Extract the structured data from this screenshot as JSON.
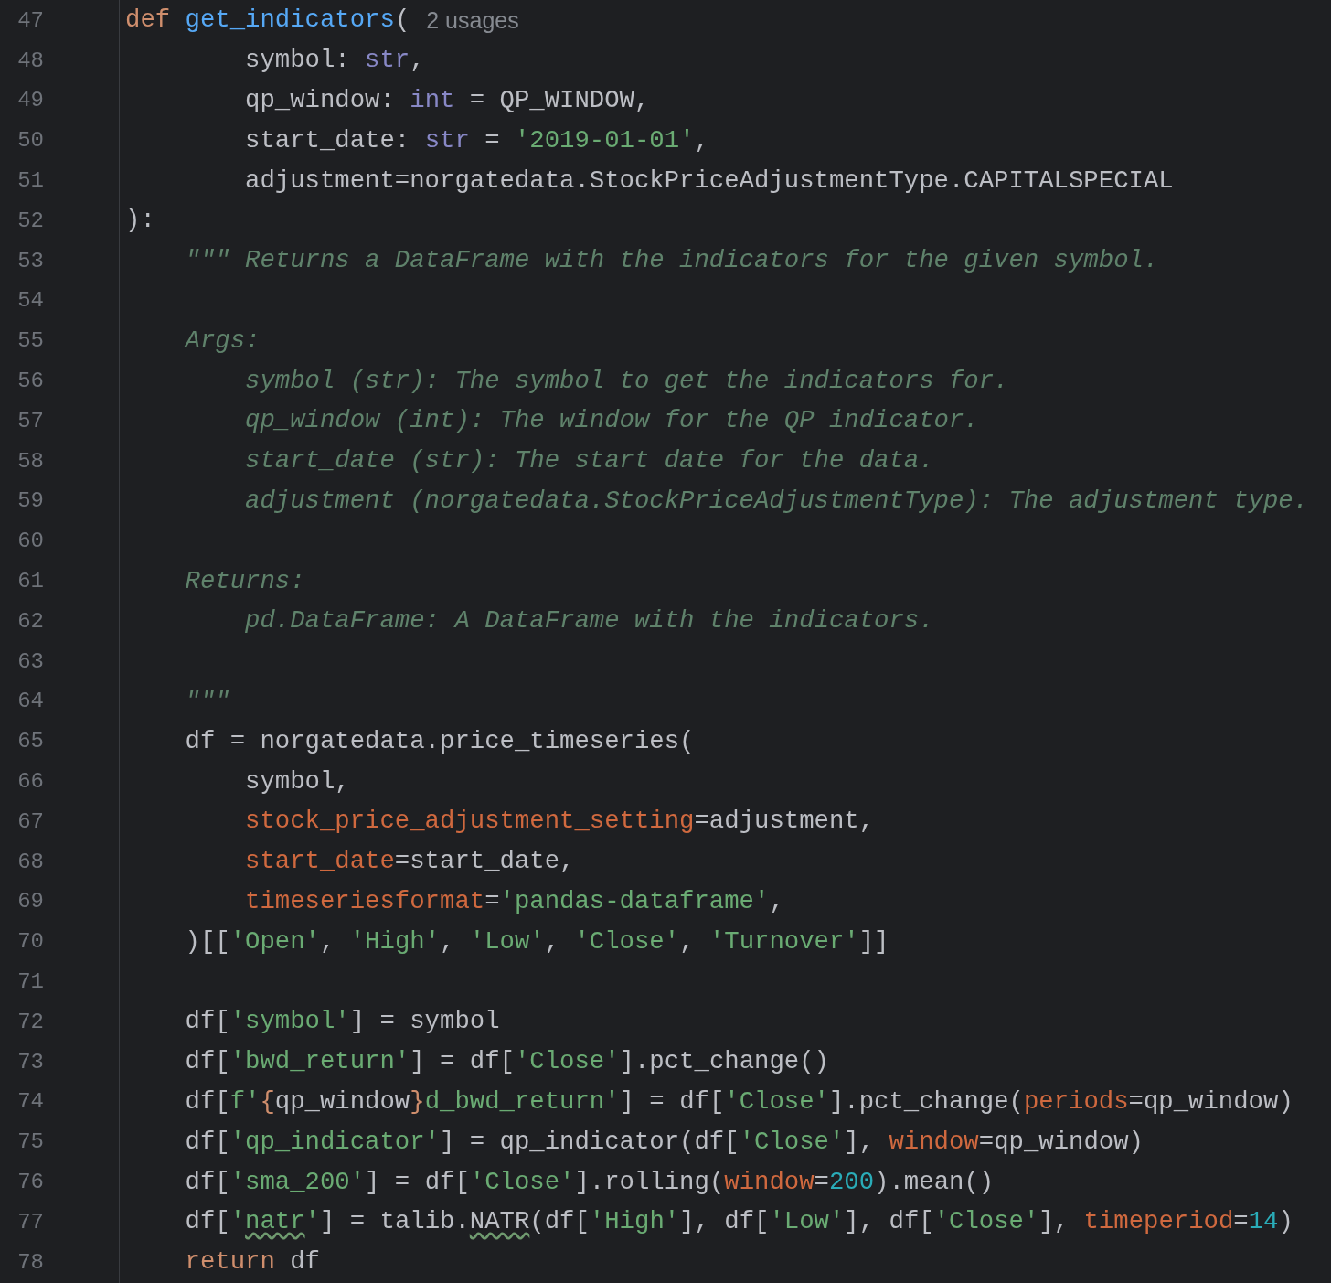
{
  "lines": [
    {
      "number": "47",
      "tokens": [
        {
          "text": "def ",
          "kind": "keyword"
        },
        {
          "text": "get_indicators",
          "kind": "function"
        },
        {
          "text": "(",
          "kind": "plain"
        },
        {
          "text": "2 usages",
          "kind": "hint"
        }
      ]
    },
    {
      "number": "48",
      "tokens": [
        {
          "text": "        symbol: ",
          "kind": "plain"
        },
        {
          "text": "str",
          "kind": "type"
        },
        {
          "text": ",",
          "kind": "plain"
        }
      ]
    },
    {
      "number": "49",
      "tokens": [
        {
          "text": "        qp_window: ",
          "kind": "plain"
        },
        {
          "text": "int",
          "kind": "type"
        },
        {
          "text": " = QP_WINDOW,",
          "kind": "plain"
        }
      ]
    },
    {
      "number": "50",
      "tokens": [
        {
          "text": "        start_date: ",
          "kind": "plain"
        },
        {
          "text": "str",
          "kind": "type"
        },
        {
          "text": " = ",
          "kind": "plain"
        },
        {
          "text": "'2019-01-01'",
          "kind": "string"
        },
        {
          "text": ",",
          "kind": "plain"
        }
      ]
    },
    {
      "number": "51",
      "tokens": [
        {
          "text": "        adjustment=norgatedata.StockPriceAdjustmentType.CAPITALSPECIAL",
          "kind": "plain"
        }
      ]
    },
    {
      "number": "52",
      "tokens": [
        {
          "text": "):",
          "kind": "plain"
        }
      ]
    },
    {
      "number": "53",
      "tokens": [
        {
          "text": "    \"\"\" Returns a DataFrame with the indicators for the given symbol.",
          "kind": "doc"
        }
      ]
    },
    {
      "number": "54"
    },
    {
      "number": "55",
      "tokens": [
        {
          "text": "    Args:",
          "kind": "doc"
        }
      ]
    },
    {
      "number": "56",
      "tokens": [
        {
          "text": "        symbol (str): The symbol to get the indicators for.",
          "kind": "doc"
        }
      ]
    },
    {
      "number": "57",
      "tokens": [
        {
          "text": "        qp_window (int): The window for the QP indicator.",
          "kind": "doc"
        }
      ]
    },
    {
      "number": "58",
      "tokens": [
        {
          "text": "        start_date (str): The start date for the data.",
          "kind": "doc"
        }
      ]
    },
    {
      "number": "59",
      "tokens": [
        {
          "text": "        adjustment (norgatedata.StockPriceAdjustmentType): The adjustment type.",
          "kind": "doc"
        }
      ]
    },
    {
      "number": "60"
    },
    {
      "number": "61",
      "tokens": [
        {
          "text": "    Returns:",
          "kind": "doc"
        }
      ]
    },
    {
      "number": "62",
      "tokens": [
        {
          "text": "        pd.DataFrame: A DataFrame with the indicators.",
          "kind": "doc"
        }
      ]
    },
    {
      "number": "63"
    },
    {
      "number": "64",
      "tokens": [
        {
          "text": "    \"\"\"",
          "kind": "doc"
        }
      ]
    },
    {
      "number": "65",
      "tokens": [
        {
          "text": "    df = norgatedata.price_timeseries(",
          "kind": "plain"
        }
      ]
    },
    {
      "number": "66",
      "tokens": [
        {
          "text": "        symbol,",
          "kind": "plain"
        }
      ]
    },
    {
      "number": "67",
      "tokens": [
        {
          "text": "        stock_price_adjustment_setting",
          "kind": "param"
        },
        {
          "text": "=adjustment,",
          "kind": "plain"
        }
      ]
    },
    {
      "number": "68",
      "tokens": [
        {
          "text": "        start_date",
          "kind": "param"
        },
        {
          "text": "=start_date,",
          "kind": "plain"
        }
      ]
    },
    {
      "number": "69",
      "tokens": [
        {
          "text": "        timeseriesformat",
          "kind": "param"
        },
        {
          "text": "=",
          "kind": "plain"
        },
        {
          "text": "'pandas-dataframe'",
          "kind": "string"
        },
        {
          "text": ",",
          "kind": "plain"
        }
      ]
    },
    {
      "number": "70",
      "tokens": [
        {
          "text": "    )[[",
          "kind": "plain"
        },
        {
          "text": "'Open'",
          "kind": "string"
        },
        {
          "text": ", ",
          "kind": "plain"
        },
        {
          "text": "'High'",
          "kind": "string"
        },
        {
          "text": ", ",
          "kind": "plain"
        },
        {
          "text": "'Low'",
          "kind": "string"
        },
        {
          "text": ", ",
          "kind": "plain"
        },
        {
          "text": "'Close'",
          "kind": "string"
        },
        {
          "text": ", ",
          "kind": "plain"
        },
        {
          "text": "'Turnover'",
          "kind": "string"
        },
        {
          "text": "]]",
          "kind": "plain"
        }
      ]
    },
    {
      "number": "71"
    },
    {
      "number": "72",
      "tokens": [
        {
          "text": "    df[",
          "kind": "plain"
        },
        {
          "text": "'symbol'",
          "kind": "string"
        },
        {
          "text": "] = symbol",
          "kind": "plain"
        }
      ]
    },
    {
      "number": "73",
      "tokens": [
        {
          "text": "    df[",
          "kind": "plain"
        },
        {
          "text": "'bwd_return'",
          "kind": "string"
        },
        {
          "text": "] = df[",
          "kind": "plain"
        },
        {
          "text": "'Close'",
          "kind": "string"
        },
        {
          "text": "].pct_change()",
          "kind": "plain"
        }
      ]
    },
    {
      "number": "74",
      "tokens": [
        {
          "text": "    df[",
          "kind": "plain"
        },
        {
          "text": "f'",
          "kind": "string"
        },
        {
          "text": "{",
          "kind": "brace"
        },
        {
          "text": "qp_window",
          "kind": "plain"
        },
        {
          "text": "}",
          "kind": "brace"
        },
        {
          "text": "d_bwd_return'",
          "kind": "string"
        },
        {
          "text": "] = df[",
          "kind": "plain"
        },
        {
          "text": "'Close'",
          "kind": "string"
        },
        {
          "text": "].pct_change(",
          "kind": "plain"
        },
        {
          "text": "periods",
          "kind": "param"
        },
        {
          "text": "=qp_window)",
          "kind": "plain"
        }
      ]
    },
    {
      "number": "75",
      "tokens": [
        {
          "text": "    df[",
          "kind": "plain"
        },
        {
          "text": "'qp_indicator'",
          "kind": "string"
        },
        {
          "text": "] = qp_indicator(df[",
          "kind": "plain"
        },
        {
          "text": "'Close'",
          "kind": "string"
        },
        {
          "text": "], ",
          "kind": "plain"
        },
        {
          "text": "window",
          "kind": "param"
        },
        {
          "text": "=qp_window)",
          "kind": "plain"
        }
      ]
    },
    {
      "number": "76",
      "tokens": [
        {
          "text": "    df[",
          "kind": "plain"
        },
        {
          "text": "'sma_200'",
          "kind": "string"
        },
        {
          "text": "] = df[",
          "kind": "plain"
        },
        {
          "text": "'Close'",
          "kind": "string"
        },
        {
          "text": "].rolling(",
          "kind": "plain"
        },
        {
          "text": "window",
          "kind": "param"
        },
        {
          "text": "=",
          "kind": "plain"
        },
        {
          "text": "200",
          "kind": "number"
        },
        {
          "text": ").mean()",
          "kind": "plain"
        }
      ]
    },
    {
      "number": "77",
      "tokens": [
        {
          "text": "    df[",
          "kind": "plain"
        },
        {
          "text": "'",
          "kind": "string"
        },
        {
          "text": "natr",
          "kind": "typostring"
        },
        {
          "text": "'",
          "kind": "string"
        },
        {
          "text": "] = talib.",
          "kind": "plain"
        },
        {
          "text": "NATR",
          "kind": "typo"
        },
        {
          "text": "(df[",
          "kind": "plain"
        },
        {
          "text": "'High'",
          "kind": "string"
        },
        {
          "text": "], df[",
          "kind": "plain"
        },
        {
          "text": "'Low'",
          "kind": "string"
        },
        {
          "text": "], df[",
          "kind": "plain"
        },
        {
          "text": "'Close'",
          "kind": "string"
        },
        {
          "text": "], ",
          "kind": "plain"
        },
        {
          "text": "timeperiod",
          "kind": "param"
        },
        {
          "text": "=",
          "kind": "plain"
        },
        {
          "text": "14",
          "kind": "number"
        },
        {
          "text": ")",
          "kind": "plain"
        }
      ]
    },
    {
      "number": "78",
      "tokens": [
        {
          "text": "    return",
          "kind": "keyword"
        },
        {
          "text": " df",
          "kind": "plain"
        }
      ]
    }
  ]
}
